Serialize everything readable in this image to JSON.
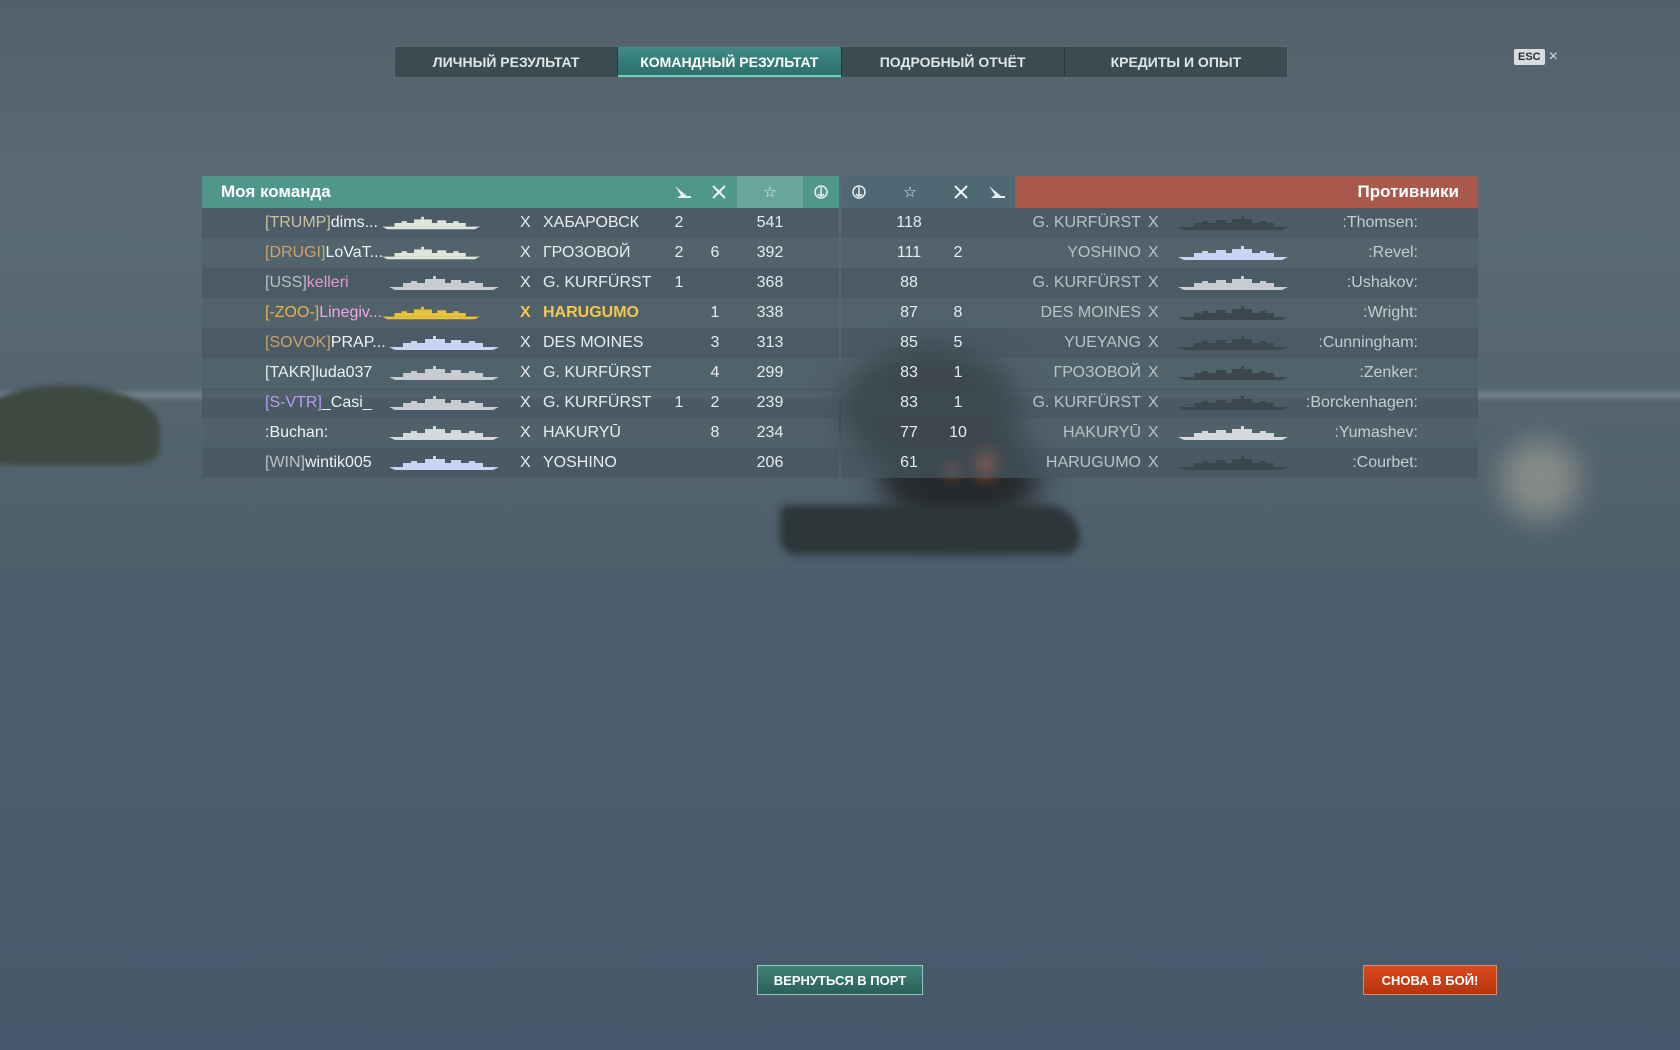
{
  "tabs": [
    {
      "label": "ЛИЧНЫЙ РЕЗУЛЬТАТ",
      "active": false
    },
    {
      "label": "КОМАНДНЫЙ РЕЗУЛЬТАТ",
      "active": true
    },
    {
      "label": "ПОДРОБНЫЙ ОТЧЁТ",
      "active": false
    },
    {
      "label": "КРЕДИТЫ И ОПЫТ",
      "active": false
    }
  ],
  "esc": {
    "key": "ESC",
    "close": "×"
  },
  "my_team": {
    "title": "Моя команда",
    "header_icons": [
      "plane-kills-icon",
      "frags-icon",
      "star-icon",
      "base-capture-icon"
    ],
    "rows": [
      {
        "clan": "[TRUMP]",
        "clan_color": "#c9c3a0",
        "nick": "dims...",
        "nick_color": "#eef2f3",
        "ship_color": "#dfe6dc",
        "tier": "X",
        "ship": "ХАБАРОВСК",
        "planes": "2",
        "frags": "",
        "xp": "541"
      },
      {
        "clan": "[DRUGI]",
        "clan_color": "#c9a46d",
        "nick": "LoVaT...",
        "nick_color": "#eef2f3",
        "ship_color": "#dfe6dc",
        "tier": "X",
        "ship": "ГРОЗОВОЙ",
        "planes": "2",
        "frags": "6",
        "xp": "392"
      },
      {
        "clan": "[USS]",
        "clan_color": "#b9c0c4",
        "nick": "kelleri",
        "nick_color": "#e59ad8",
        "ship_color": "#c7ccd0",
        "tier": "X",
        "ship": "G. KURFÜRST",
        "planes": "1",
        "frags": "",
        "xp": "368"
      },
      {
        "clan": "[-ZOO-]",
        "clan_color": "#e8b24a",
        "nick": "Linegiv...",
        "nick_color": "#f0a6e6",
        "ship_color": "#e8c23a",
        "tier": "X",
        "ship": "HARUGUMO",
        "planes": "",
        "frags": "1",
        "xp": "338",
        "self": true
      },
      {
        "clan": "[SOVOK]",
        "clan_color": "#c9a46d",
        "nick": "PRAP...",
        "nick_color": "#eef2f3",
        "ship_color": "#c9d4f2",
        "tier": "X",
        "ship": "DES MOINES",
        "planes": "",
        "frags": "3",
        "xp": "313"
      },
      {
        "clan": "[TAKR]",
        "clan_color": "#e6ecef",
        "nick": "luda037",
        "nick_color": "#eef2f3",
        "ship_color": "#c7ccd0",
        "tier": "X",
        "ship": "G. KURFÜRST",
        "planes": "",
        "frags": "4",
        "xp": "299"
      },
      {
        "clan": "[S-VTR]",
        "clan_color": "#b79cf0",
        "nick": "_Casi_",
        "nick_color": "#eef2f3",
        "ship_color": "#c7ccd0",
        "tier": "X",
        "ship": "G. KURFÜRST",
        "planes": "1",
        "frags": "2",
        "xp": "239"
      },
      {
        "clan": "",
        "clan_color": "#e6ecef",
        "nick": ":Buchan:",
        "nick_color": "#eef2f3",
        "ship_color": "#d4d9dc",
        "tier": "X",
        "ship": "HAKURYŪ",
        "planes": "",
        "frags": "8",
        "xp": "234"
      },
      {
        "clan": "[WIN]",
        "clan_color": "#b9c0c4",
        "nick": "wintik005",
        "nick_color": "#eef2f3",
        "ship_color": "#c9d4f2",
        "tier": "X",
        "ship": "YOSHINO",
        "planes": "",
        "frags": "",
        "xp": "206"
      }
    ]
  },
  "enemy_team": {
    "title": "Противники",
    "header_icons": [
      "base-capture-icon",
      "star-icon",
      "frags-icon",
      "plane-kills-icon"
    ],
    "rows": [
      {
        "xp": "118",
        "frags": "",
        "planes": "",
        "ship": "G. KURFÜRST",
        "tier": "X",
        "nick": ":Thomsen:",
        "ship_color": "#3c474d"
      },
      {
        "xp": "111",
        "frags": "2",
        "planes": "",
        "ship": "YOSHINO",
        "tier": "X",
        "nick": ":Revel:",
        "ship_color": "#c9d4f2"
      },
      {
        "xp": "88",
        "frags": "",
        "planes": "",
        "ship": "G. KURFÜRST",
        "tier": "X",
        "nick": ":Ushakov:",
        "ship_color": "#c7ccd0"
      },
      {
        "xp": "87",
        "frags": "8",
        "planes": "",
        "ship": "DES MOINES",
        "tier": "X",
        "nick": ":Wright:",
        "ship_color": "#3c474d"
      },
      {
        "xp": "85",
        "frags": "5",
        "planes": "",
        "ship": "YUEYANG",
        "tier": "X",
        "nick": ":Cunningham:",
        "ship_color": "#3c474d"
      },
      {
        "xp": "83",
        "frags": "1",
        "planes": "",
        "ship": "ГРОЗОВОЙ",
        "tier": "X",
        "nick": ":Zenker:",
        "ship_color": "#3c474d"
      },
      {
        "xp": "83",
        "frags": "1",
        "planes": "",
        "ship": "G. KURFÜRST",
        "tier": "X",
        "nick": ":Borckenhagen:",
        "ship_color": "#3c474d"
      },
      {
        "xp": "77",
        "frags": "10",
        "planes": "",
        "ship": "HAKURYŪ",
        "tier": "X",
        "nick": ":Yumashev:",
        "ship_color": "#d4d9dc"
      },
      {
        "xp": "61",
        "frags": "",
        "planes": "",
        "ship": "HARUGUMO",
        "tier": "X",
        "nick": ":Courbet:",
        "ship_color": "#3c474d"
      }
    ]
  },
  "buttons": {
    "to_port": "ВЕРНУТЬСЯ В ПОРТ",
    "battle_again": "СНОВА В БОЙ!"
  }
}
